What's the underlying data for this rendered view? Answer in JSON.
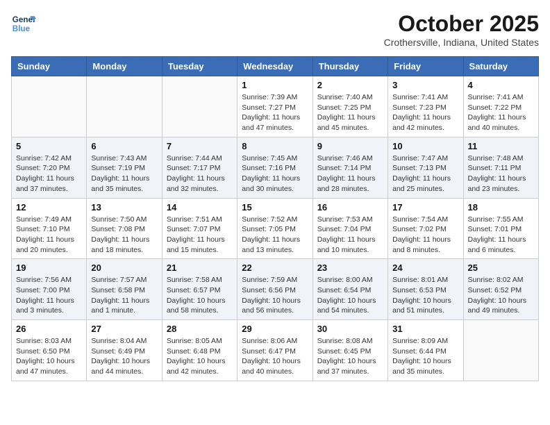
{
  "header": {
    "logo_line1": "General",
    "logo_line2": "Blue",
    "month": "October 2025",
    "location": "Crothersville, Indiana, United States"
  },
  "weekdays": [
    "Sunday",
    "Monday",
    "Tuesday",
    "Wednesday",
    "Thursday",
    "Friday",
    "Saturday"
  ],
  "weeks": [
    [
      {
        "day": "",
        "sunrise": "",
        "sunset": "",
        "daylight": ""
      },
      {
        "day": "",
        "sunrise": "",
        "sunset": "",
        "daylight": ""
      },
      {
        "day": "",
        "sunrise": "",
        "sunset": "",
        "daylight": ""
      },
      {
        "day": "1",
        "sunrise": "Sunrise: 7:39 AM",
        "sunset": "Sunset: 7:27 PM",
        "daylight": "Daylight: 11 hours and 47 minutes."
      },
      {
        "day": "2",
        "sunrise": "Sunrise: 7:40 AM",
        "sunset": "Sunset: 7:25 PM",
        "daylight": "Daylight: 11 hours and 45 minutes."
      },
      {
        "day": "3",
        "sunrise": "Sunrise: 7:41 AM",
        "sunset": "Sunset: 7:23 PM",
        "daylight": "Daylight: 11 hours and 42 minutes."
      },
      {
        "day": "4",
        "sunrise": "Sunrise: 7:41 AM",
        "sunset": "Sunset: 7:22 PM",
        "daylight": "Daylight: 11 hours and 40 minutes."
      }
    ],
    [
      {
        "day": "5",
        "sunrise": "Sunrise: 7:42 AM",
        "sunset": "Sunset: 7:20 PM",
        "daylight": "Daylight: 11 hours and 37 minutes."
      },
      {
        "day": "6",
        "sunrise": "Sunrise: 7:43 AM",
        "sunset": "Sunset: 7:19 PM",
        "daylight": "Daylight: 11 hours and 35 minutes."
      },
      {
        "day": "7",
        "sunrise": "Sunrise: 7:44 AM",
        "sunset": "Sunset: 7:17 PM",
        "daylight": "Daylight: 11 hours and 32 minutes."
      },
      {
        "day": "8",
        "sunrise": "Sunrise: 7:45 AM",
        "sunset": "Sunset: 7:16 PM",
        "daylight": "Daylight: 11 hours and 30 minutes."
      },
      {
        "day": "9",
        "sunrise": "Sunrise: 7:46 AM",
        "sunset": "Sunset: 7:14 PM",
        "daylight": "Daylight: 11 hours and 28 minutes."
      },
      {
        "day": "10",
        "sunrise": "Sunrise: 7:47 AM",
        "sunset": "Sunset: 7:13 PM",
        "daylight": "Daylight: 11 hours and 25 minutes."
      },
      {
        "day": "11",
        "sunrise": "Sunrise: 7:48 AM",
        "sunset": "Sunset: 7:11 PM",
        "daylight": "Daylight: 11 hours and 23 minutes."
      }
    ],
    [
      {
        "day": "12",
        "sunrise": "Sunrise: 7:49 AM",
        "sunset": "Sunset: 7:10 PM",
        "daylight": "Daylight: 11 hours and 20 minutes."
      },
      {
        "day": "13",
        "sunrise": "Sunrise: 7:50 AM",
        "sunset": "Sunset: 7:08 PM",
        "daylight": "Daylight: 11 hours and 18 minutes."
      },
      {
        "day": "14",
        "sunrise": "Sunrise: 7:51 AM",
        "sunset": "Sunset: 7:07 PM",
        "daylight": "Daylight: 11 hours and 15 minutes."
      },
      {
        "day": "15",
        "sunrise": "Sunrise: 7:52 AM",
        "sunset": "Sunset: 7:05 PM",
        "daylight": "Daylight: 11 hours and 13 minutes."
      },
      {
        "day": "16",
        "sunrise": "Sunrise: 7:53 AM",
        "sunset": "Sunset: 7:04 PM",
        "daylight": "Daylight: 11 hours and 10 minutes."
      },
      {
        "day": "17",
        "sunrise": "Sunrise: 7:54 AM",
        "sunset": "Sunset: 7:02 PM",
        "daylight": "Daylight: 11 hours and 8 minutes."
      },
      {
        "day": "18",
        "sunrise": "Sunrise: 7:55 AM",
        "sunset": "Sunset: 7:01 PM",
        "daylight": "Daylight: 11 hours and 6 minutes."
      }
    ],
    [
      {
        "day": "19",
        "sunrise": "Sunrise: 7:56 AM",
        "sunset": "Sunset: 7:00 PM",
        "daylight": "Daylight: 11 hours and 3 minutes."
      },
      {
        "day": "20",
        "sunrise": "Sunrise: 7:57 AM",
        "sunset": "Sunset: 6:58 PM",
        "daylight": "Daylight: 11 hours and 1 minute."
      },
      {
        "day": "21",
        "sunrise": "Sunrise: 7:58 AM",
        "sunset": "Sunset: 6:57 PM",
        "daylight": "Daylight: 10 hours and 58 minutes."
      },
      {
        "day": "22",
        "sunrise": "Sunrise: 7:59 AM",
        "sunset": "Sunset: 6:56 PM",
        "daylight": "Daylight: 10 hours and 56 minutes."
      },
      {
        "day": "23",
        "sunrise": "Sunrise: 8:00 AM",
        "sunset": "Sunset: 6:54 PM",
        "daylight": "Daylight: 10 hours and 54 minutes."
      },
      {
        "day": "24",
        "sunrise": "Sunrise: 8:01 AM",
        "sunset": "Sunset: 6:53 PM",
        "daylight": "Daylight: 10 hours and 51 minutes."
      },
      {
        "day": "25",
        "sunrise": "Sunrise: 8:02 AM",
        "sunset": "Sunset: 6:52 PM",
        "daylight": "Daylight: 10 hours and 49 minutes."
      }
    ],
    [
      {
        "day": "26",
        "sunrise": "Sunrise: 8:03 AM",
        "sunset": "Sunset: 6:50 PM",
        "daylight": "Daylight: 10 hours and 47 minutes."
      },
      {
        "day": "27",
        "sunrise": "Sunrise: 8:04 AM",
        "sunset": "Sunset: 6:49 PM",
        "daylight": "Daylight: 10 hours and 44 minutes."
      },
      {
        "day": "28",
        "sunrise": "Sunrise: 8:05 AM",
        "sunset": "Sunset: 6:48 PM",
        "daylight": "Daylight: 10 hours and 42 minutes."
      },
      {
        "day": "29",
        "sunrise": "Sunrise: 8:06 AM",
        "sunset": "Sunset: 6:47 PM",
        "daylight": "Daylight: 10 hours and 40 minutes."
      },
      {
        "day": "30",
        "sunrise": "Sunrise: 8:08 AM",
        "sunset": "Sunset: 6:45 PM",
        "daylight": "Daylight: 10 hours and 37 minutes."
      },
      {
        "day": "31",
        "sunrise": "Sunrise: 8:09 AM",
        "sunset": "Sunset: 6:44 PM",
        "daylight": "Daylight: 10 hours and 35 minutes."
      },
      {
        "day": "",
        "sunrise": "",
        "sunset": "",
        "daylight": ""
      }
    ]
  ]
}
